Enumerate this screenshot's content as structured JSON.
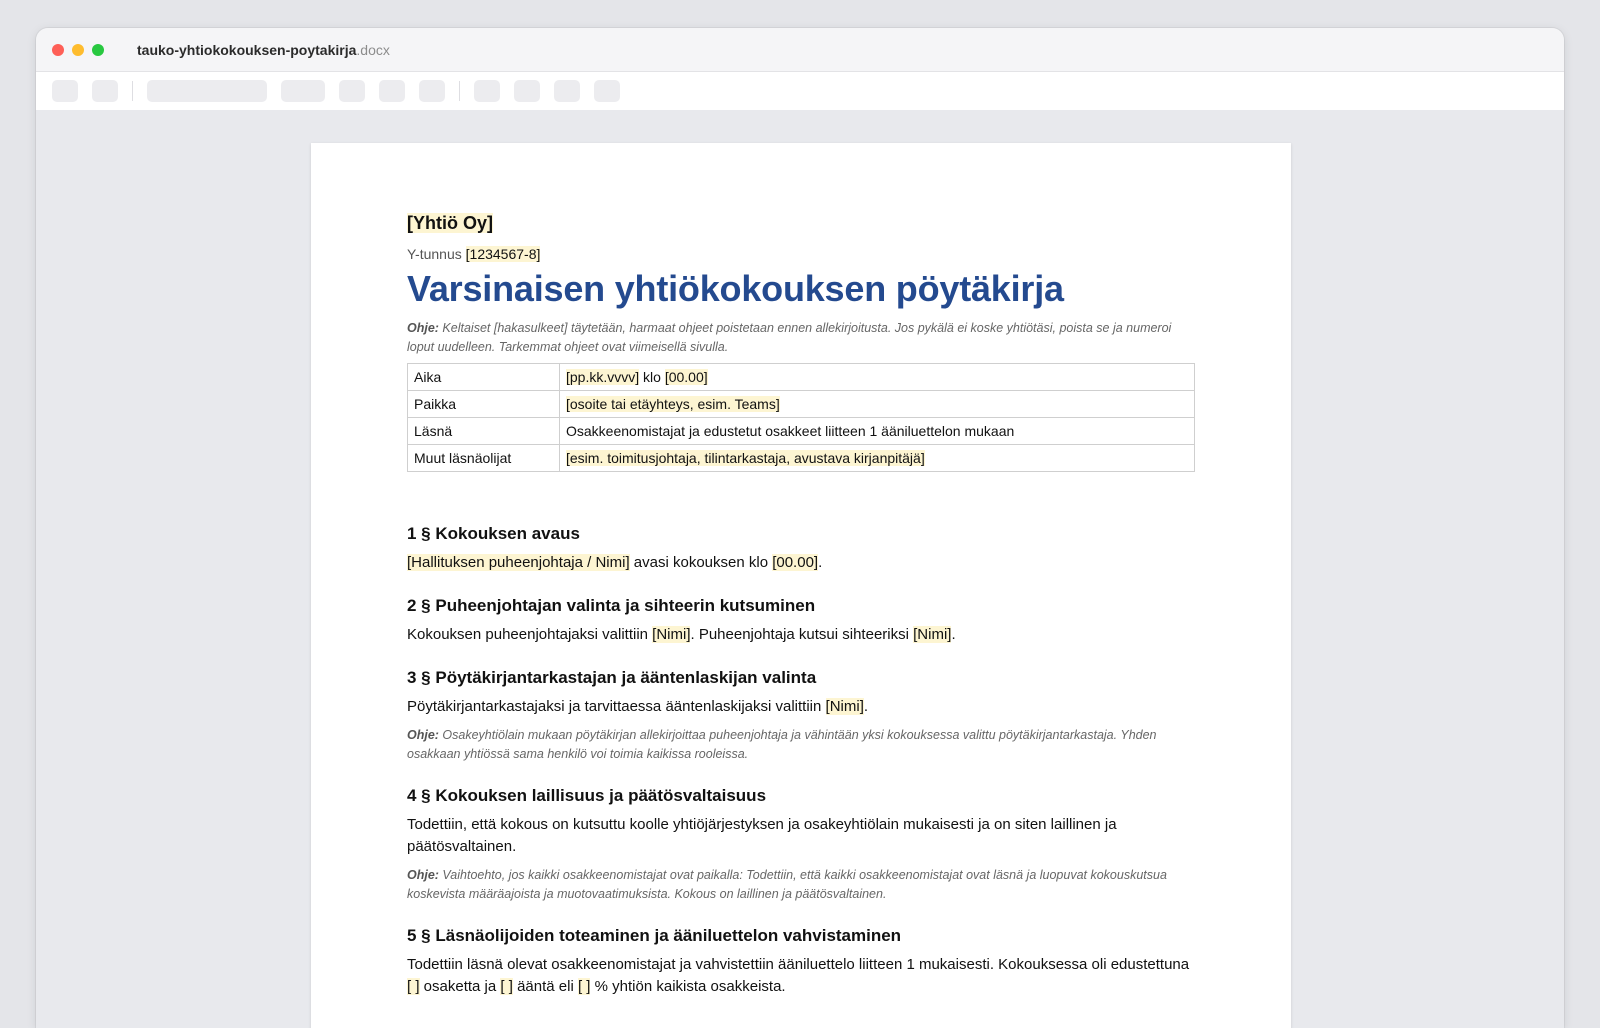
{
  "window": {
    "file_base": "tauko-yhtiokokouksen-poytakirja",
    "file_ext": ".docx"
  },
  "document": {
    "company": "[Yhtiö Oy]",
    "ytunnus_label": "Y-tunnus",
    "ytunnus_value": "[1234567-8]",
    "title": "Varsinaisen yhtiökokouksen pöytäkirja",
    "guide_label": "Ohje:",
    "guide_text": " Keltaiset [hakasulkeet] täytetään, harmaat ohjeet poistetaan ennen allekirjoitusta. Jos pykälä ei koske yhtiötäsi, poista se ja numeroi loput uudelleen. Tarkemmat ohjeet ovat viimeisellä sivulla.",
    "meta": {
      "aika_label": "Aika",
      "aika_date": "[pp.kk.vvvv]",
      "aika_klo": " klo ",
      "aika_time": "[00.00]",
      "paikka_label": "Paikka",
      "paikka_value": "[osoite tai etäyhteys, esim. Teams]",
      "lasna_label": "Läsnä",
      "lasna_value": "Osakkeenomistajat ja edustetut osakkeet liitteen 1 ääniluettelon mukaan",
      "muut_label": "Muut läsnäolijat",
      "muut_value": "[esim. toimitusjohtaja, tilintarkastaja, avustava kirjanpitäjä]"
    },
    "s1": {
      "heading": "1 § Kokouksen avaus",
      "f1": "[Hallituksen puheenjohtaja / Nimi]",
      "t1": " avasi kokouksen klo ",
      "f2": "[00.00]",
      "t2": "."
    },
    "s2": {
      "heading": "2 § Puheenjohtajan valinta ja sihteerin kutsuminen",
      "t1": "Kokouksen puheenjohtajaksi valittiin ",
      "f1": "[Nimi]",
      "t2": ". Puheenjohtaja kutsui sihteeriksi ",
      "f2": "[Nimi]",
      "t3": "."
    },
    "s3": {
      "heading": "3 § Pöytäkirjantarkastajan ja ääntenlaskijan valinta",
      "t1": "Pöytäkirjantarkastajaksi ja tarvittaessa ääntenlaskijaksi valittiin ",
      "f1": "[Nimi]",
      "t2": ".",
      "guide_label": "Ohje:",
      "guide_text": " Osakeyhtiölain mukaan pöytäkirjan allekirjoittaa puheenjohtaja ja vähintään yksi kokouksessa valittu pöytäkirjantarkastaja. Yhden osakkaan yhtiössä sama henkilö voi toimia kaikissa rooleissa."
    },
    "s4": {
      "heading": "4 § Kokouksen laillisuus ja päätösvaltaisuus",
      "text": "Todettiin, että kokous on kutsuttu koolle yhtiöjärjestyksen ja osakeyhtiölain mukaisesti ja on siten laillinen ja päätösvaltainen.",
      "guide_label": "Ohje:",
      "guide_text": " Vaihtoehto, jos kaikki osakkeenomistajat ovat paikalla: Todettiin, että kaikki osakkeenomistajat ovat läsnä ja luopuvat kokouskutsua koskevista määräajoista ja muotovaatimuksista. Kokous on laillinen ja päätösvaltainen."
    },
    "s5": {
      "heading": "5 § Läsnäolijoiden toteaminen ja ääniluettelon vahvistaminen",
      "t1": "Todettiin läsnä olevat osakkeenomistajat ja vahvistettiin ääniluettelo liitteen 1 mukaisesti. Kokouksessa oli edustettuna ",
      "f1": "[ ]",
      "t2": " osaketta ja ",
      "f2": "[ ]",
      "t3": " ääntä eli ",
      "f3": "[ ]",
      "t4": " % yhtiön kaikista osakkeista."
    }
  }
}
